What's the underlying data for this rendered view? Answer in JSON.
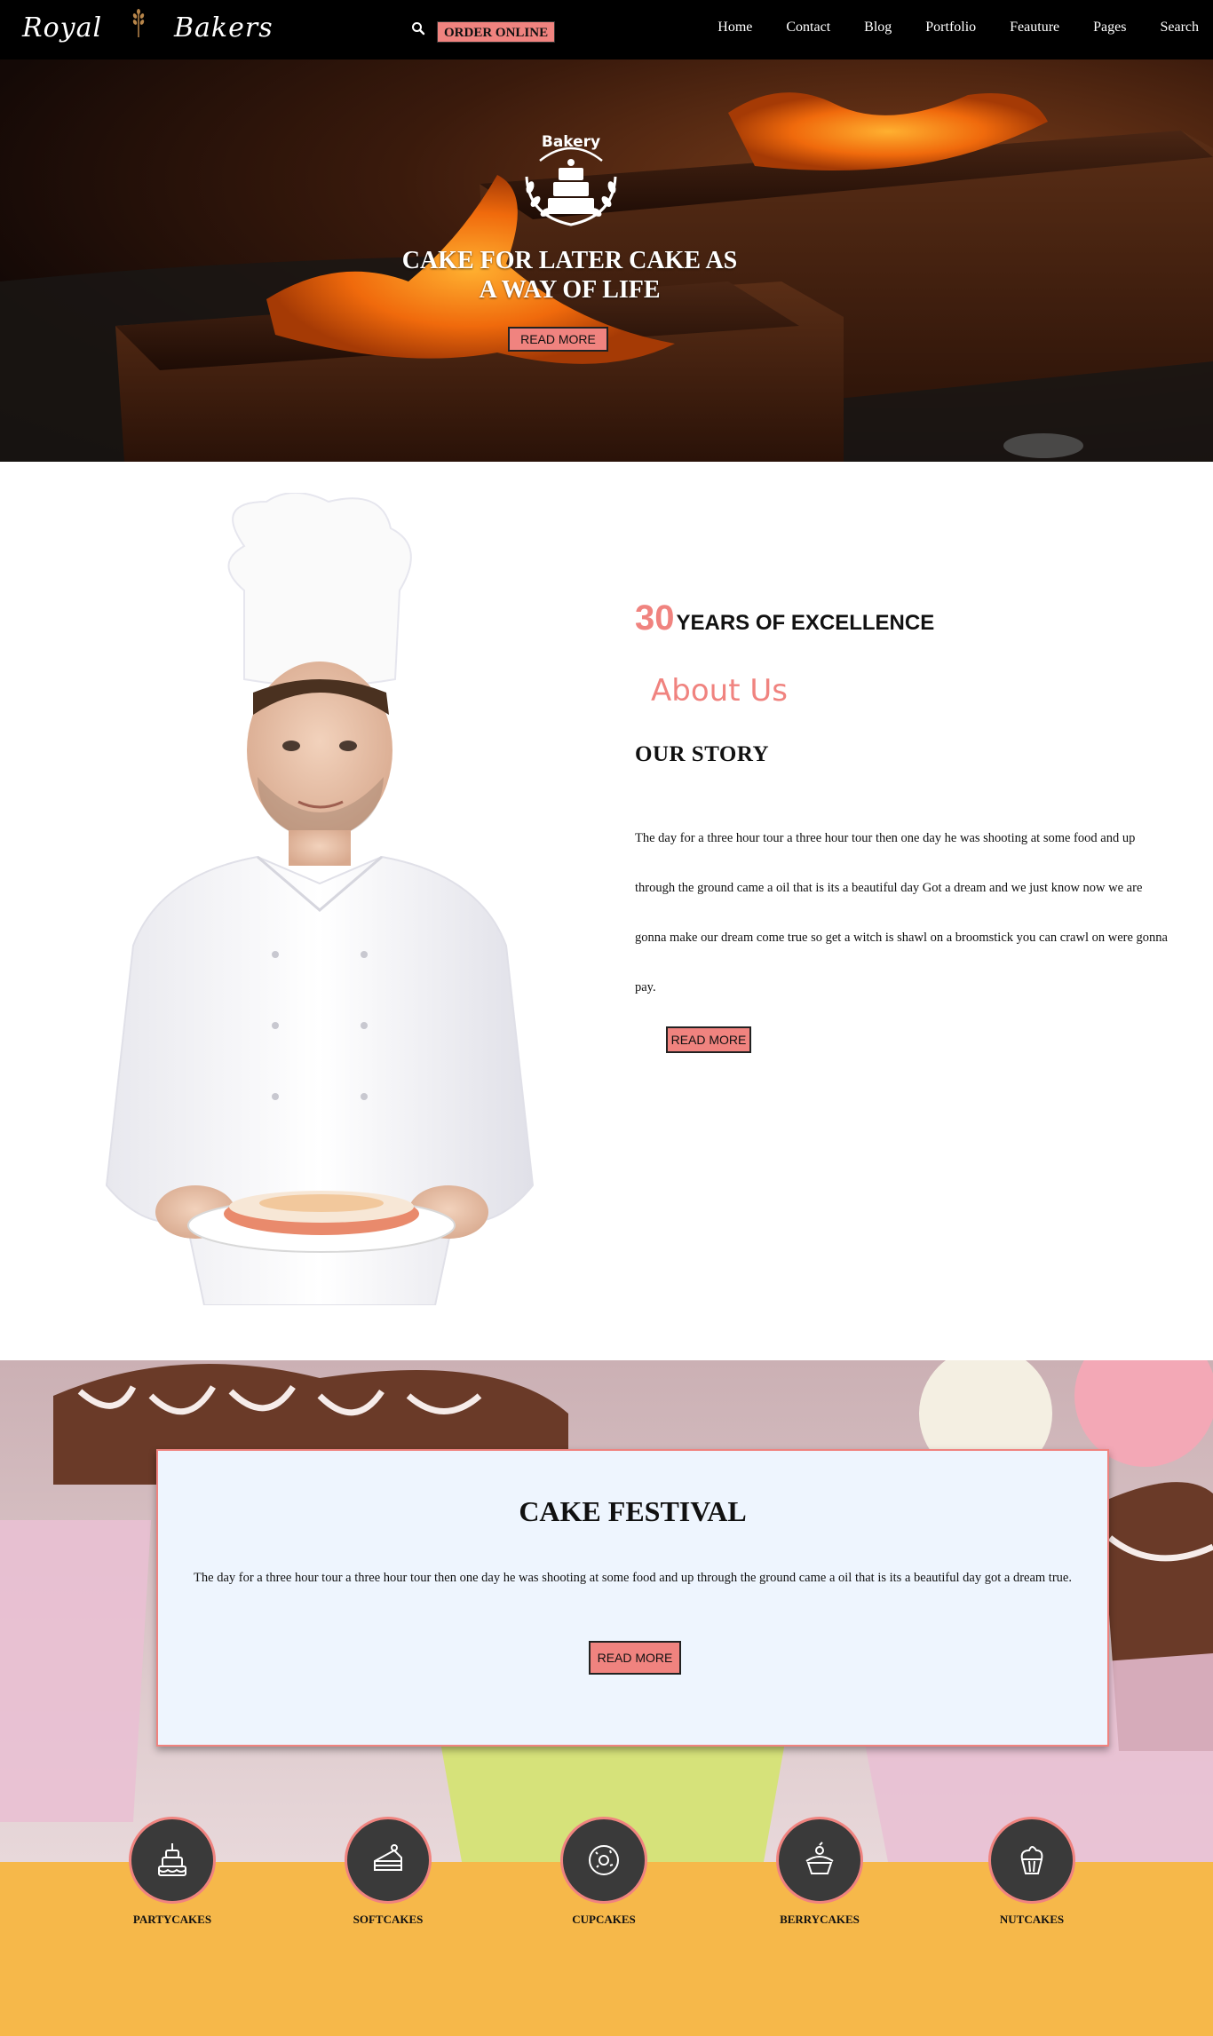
{
  "header": {
    "logo_left": "Royal",
    "logo_right": "Bakers",
    "order_button": "ORDER ONLINE",
    "nav": [
      "Home",
      "Contact",
      "Blog",
      "Portfolio",
      "Feauture",
      "Pages",
      "Search"
    ]
  },
  "hero": {
    "emblem_text": "Bakery",
    "title_line1": "CAKE FOR LATER CAKE AS",
    "title_line2": "A WAY OF LIFE",
    "button": "READ MORE"
  },
  "about": {
    "years_number": "30",
    "years_text": "YEARS OF EXCELLENCE",
    "about_title": "About Us",
    "story_title": "OUR STORY",
    "story_body": "The day for a three hour tour a three hour tour then one day he was shooting at some food and up through the ground came a oil that is its a beautiful day Got a dream and we just know now we are gonna make our dream come true so get a witch is shawl on a broomstick you can crawl on were gonna pay.",
    "button": "READ MORE"
  },
  "festival": {
    "title": "CAKE FESTIVAL",
    "body": "The day for a three hour tour a three hour tour then one day he was shooting at some food and up through the ground came a oil that is its a beautiful day got a dream true.",
    "button": "READ MORE"
  },
  "categories": [
    {
      "label": "PARTYCAKES",
      "icon": "party-cake-icon"
    },
    {
      "label": "SOFTCAKES",
      "icon": "cake-slice-icon"
    },
    {
      "label": "CUPCAKES",
      "icon": "donut-icon"
    },
    {
      "label": "BERRYCAKES",
      "icon": "berry-cake-icon"
    },
    {
      "label": "NUTCAKES",
      "icon": "cupcake-icon"
    }
  ],
  "colors": {
    "accent": "#f0837f",
    "nav_bg": "#000000",
    "category_bg": "#f6b84a",
    "card_bg": "#eef5fe"
  }
}
